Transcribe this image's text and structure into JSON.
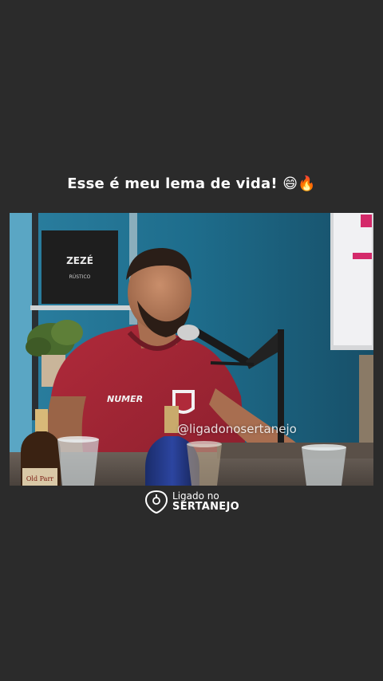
{
  "post": {
    "caption": "Esse é meu lema de vida! 😄🔥"
  },
  "video": {
    "watermark": "@ligadonosertanejo",
    "shirt_brand": "NUMER",
    "box_logo_top": "ZEZÉ",
    "box_logo_bottom": "RÚSTICO",
    "bottle_label": "Old Parr"
  },
  "brand": {
    "line1": "Ligado no",
    "line2": "SERTANEJO"
  }
}
